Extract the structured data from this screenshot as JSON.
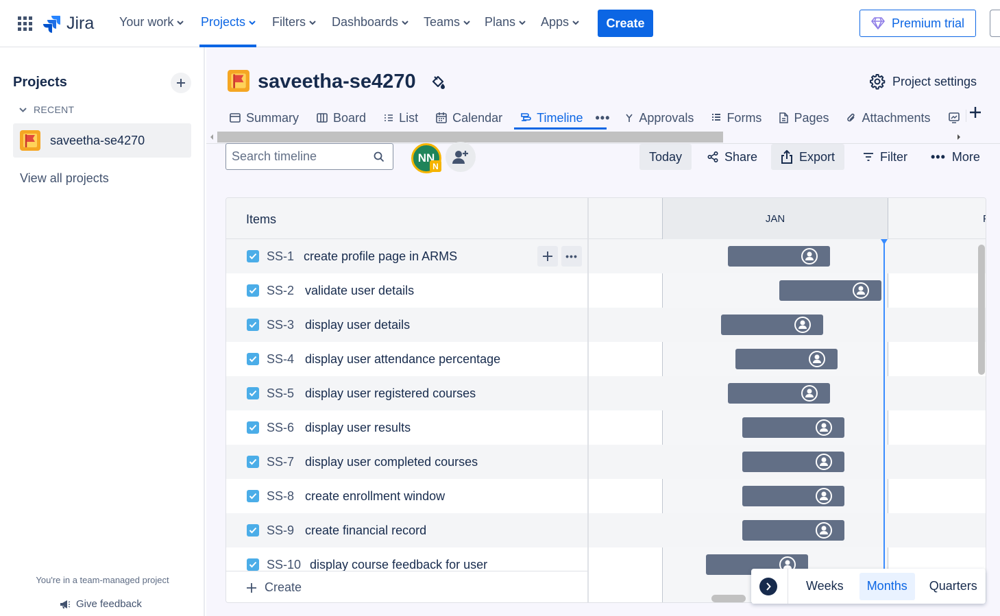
{
  "topnav": {
    "logo_text": "Jira",
    "items": [
      {
        "label": "Your work"
      },
      {
        "label": "Projects",
        "active": true
      },
      {
        "label": "Filters"
      },
      {
        "label": "Dashboards"
      },
      {
        "label": "Teams"
      },
      {
        "label": "Plans"
      },
      {
        "label": "Apps"
      }
    ],
    "create_label": "Create",
    "premium_label": "Premium trial"
  },
  "sidebar": {
    "title": "Projects",
    "recent_label": "RECENT",
    "project_name": "saveetha-se4270",
    "view_all": "View all projects",
    "footer_note": "You're in a team-managed project",
    "feedback": "Give feedback"
  },
  "project": {
    "title": "saveetha-se4270",
    "settings_label": "Project settings"
  },
  "tabs": [
    {
      "label": "Summary",
      "icon": "summary-icon"
    },
    {
      "label": "Board",
      "icon": "board-icon"
    },
    {
      "label": "List",
      "icon": "list-icon"
    },
    {
      "label": "Calendar",
      "icon": "calendar-icon"
    },
    {
      "label": "Timeline",
      "icon": "timeline-icon",
      "active": true
    },
    {
      "label": "Approvals",
      "icon": "approvals-icon"
    },
    {
      "label": "Forms",
      "icon": "forms-icon"
    },
    {
      "label": "Pages",
      "icon": "pages-icon"
    },
    {
      "label": "Attachments",
      "icon": "attachments-icon"
    }
  ],
  "toolbar": {
    "search_placeholder": "Search timeline",
    "avatar_initials": "NN",
    "avatar_badge": "N",
    "today_label": "Today",
    "share_label": "Share",
    "export_label": "Export",
    "filter_label": "Filter",
    "more_label": "More"
  },
  "timeline": {
    "items_header": "Items",
    "month_label": "JAN",
    "next_month_partial": "F",
    "create_label": "Create",
    "rows": [
      {
        "key": "SS-1",
        "title": "create profile page in ARMS"
      },
      {
        "key": "SS-2",
        "title": "validate user details"
      },
      {
        "key": "SS-3",
        "title": "display user details"
      },
      {
        "key": "SS-4",
        "title": "display user attendance percentage"
      },
      {
        "key": "SS-5",
        "title": "display user registered courses"
      },
      {
        "key": "SS-6",
        "title": "display user results"
      },
      {
        "key": "SS-7",
        "title": "display user completed courses"
      },
      {
        "key": "SS-8",
        "title": "create enrollment window"
      },
      {
        "key": "SS-9",
        "title": "create financial record"
      },
      {
        "key": "SS-10",
        "title": "display course feedback for user"
      }
    ]
  },
  "scale": {
    "options": [
      "Weeks",
      "Months",
      "Quarters"
    ],
    "selected": "Months"
  },
  "colors": {
    "accent": "#0c66e4",
    "bar": "#626f86",
    "today_line": "#388bff",
    "checkbox": "#4bade8"
  }
}
